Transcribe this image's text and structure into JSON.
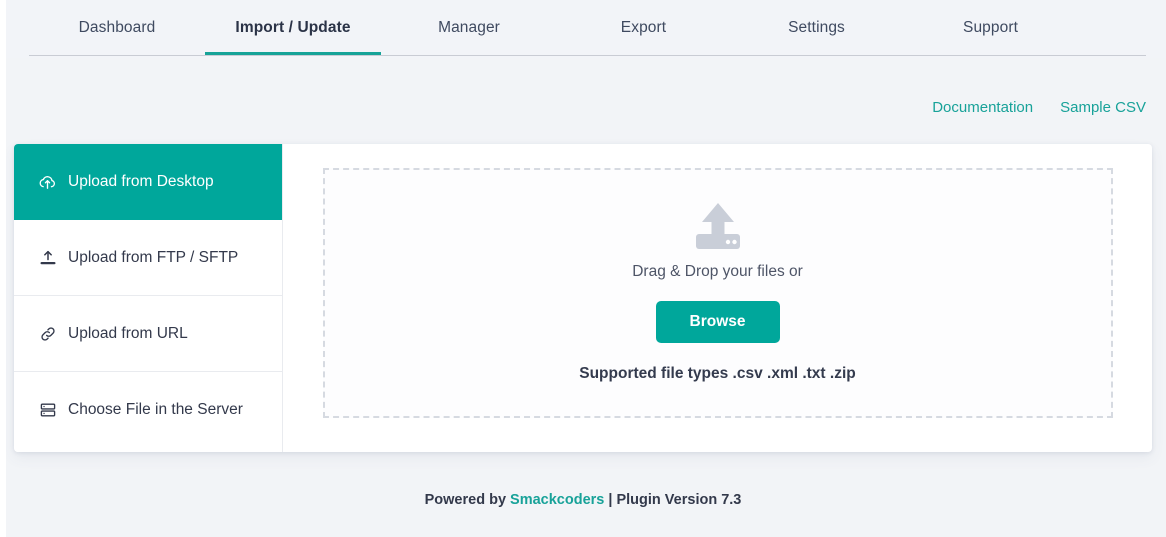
{
  "nav": {
    "tabs": [
      {
        "label": "Dashboard",
        "active": false
      },
      {
        "label": "Import / Update",
        "active": true
      },
      {
        "label": "Manager",
        "active": false
      },
      {
        "label": "Export",
        "active": false
      },
      {
        "label": "Settings",
        "active": false
      },
      {
        "label": "Support",
        "active": false
      }
    ]
  },
  "utility_links": [
    {
      "label": "Documentation"
    },
    {
      "label": "Sample CSV"
    }
  ],
  "sidebar": {
    "items": [
      {
        "label": "Upload from Desktop",
        "icon": "cloud-upload-icon",
        "active": true
      },
      {
        "label": "Upload from FTP / SFTP",
        "icon": "upload-icon",
        "active": false
      },
      {
        "label": "Upload from URL",
        "icon": "link-icon",
        "active": false
      },
      {
        "label": "Choose File in the Server",
        "icon": "server-icon",
        "active": false
      }
    ]
  },
  "dropzone": {
    "icon": "file-upload-icon",
    "prompt": "Drag & Drop your files or",
    "browse_label": "Browse",
    "supported_types": "Supported file types .csv .xml .txt .zip"
  },
  "footer": {
    "prefix": "Powered by ",
    "brand": "Smackcoders",
    "suffix": " | Plugin Version 7.3"
  },
  "colors": {
    "accent": "#00a79b",
    "link": "#18a299",
    "page_bg": "#f2f4f7",
    "text": "#33394b"
  }
}
